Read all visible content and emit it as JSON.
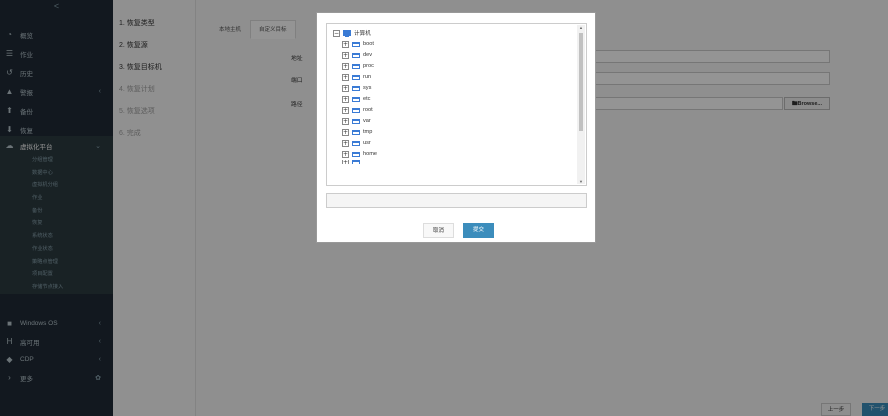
{
  "sidebar": {
    "collapse_glyph": "<",
    "items": [
      {
        "label": "概览",
        "icon": "dashboard-icon",
        "glyph": "◔"
      },
      {
        "label": "作业",
        "icon": "list-icon",
        "glyph": "☰"
      },
      {
        "label": "历史",
        "icon": "history-icon",
        "glyph": "↺"
      },
      {
        "label": "警报",
        "icon": "warning-icon",
        "glyph": "▲",
        "arrow": "‹"
      },
      {
        "label": "备份",
        "icon": "upload-icon",
        "glyph": "⬆"
      },
      {
        "label": "恢复",
        "icon": "download-icon",
        "glyph": "⬇"
      },
      {
        "label": "虚拟化平台",
        "icon": "cloud-icon",
        "glyph": "☁",
        "arrow": "⌄"
      }
    ],
    "sub_items": [
      "分组管理",
      "数据中心",
      "虚拟机分组",
      "作业",
      "备份",
      "恢复",
      "系统状态",
      "作业状态",
      "策略点管理",
      "项目配置",
      "存储节点接入"
    ],
    "items_bottom": [
      {
        "label": "Windows OS",
        "icon": "windows-icon",
        "glyph": "■",
        "arrow": "‹"
      },
      {
        "label": "高可用",
        "icon": "h-icon",
        "glyph": "H",
        "arrow": "‹"
      },
      {
        "label": "CDP",
        "icon": "shield-icon",
        "glyph": "◆",
        "arrow": "‹"
      },
      {
        "label": "更多",
        "icon": "more-icon",
        "glyph": "›",
        "arrow": "✿"
      }
    ]
  },
  "steps": [
    {
      "label": "1. 恢复类型",
      "state": "done"
    },
    {
      "label": "2. 恢复源",
      "state": "done"
    },
    {
      "label": "3. 恢复目标机",
      "state": "done"
    },
    {
      "label": "4. 恢复计划",
      "state": "todo"
    },
    {
      "label": "5. 恢复选项",
      "state": "todo"
    },
    {
      "label": "6. 完成",
      "state": "todo"
    }
  ],
  "main": {
    "tabs": [
      "本地主机",
      "自定义目标"
    ],
    "labels": {
      "address": "地址",
      "port": "端口",
      "path": "路径"
    },
    "browse_label": "🖿Browse...",
    "prev_label": "上一步",
    "next_label": "下一步"
  },
  "modal": {
    "tree_root": "计算机",
    "tree_items": [
      "boot",
      "dev",
      "proc",
      "run",
      "sys",
      "etc",
      "root",
      "var",
      "tmp",
      "usr",
      "home"
    ],
    "path_value": "",
    "cancel_label": "取消",
    "ok_label": "提交"
  },
  "colors": {
    "sidebar_bg": "#1f2a36",
    "primary": "#3c8dbc",
    "disk_blue": "#3a7bd5"
  }
}
